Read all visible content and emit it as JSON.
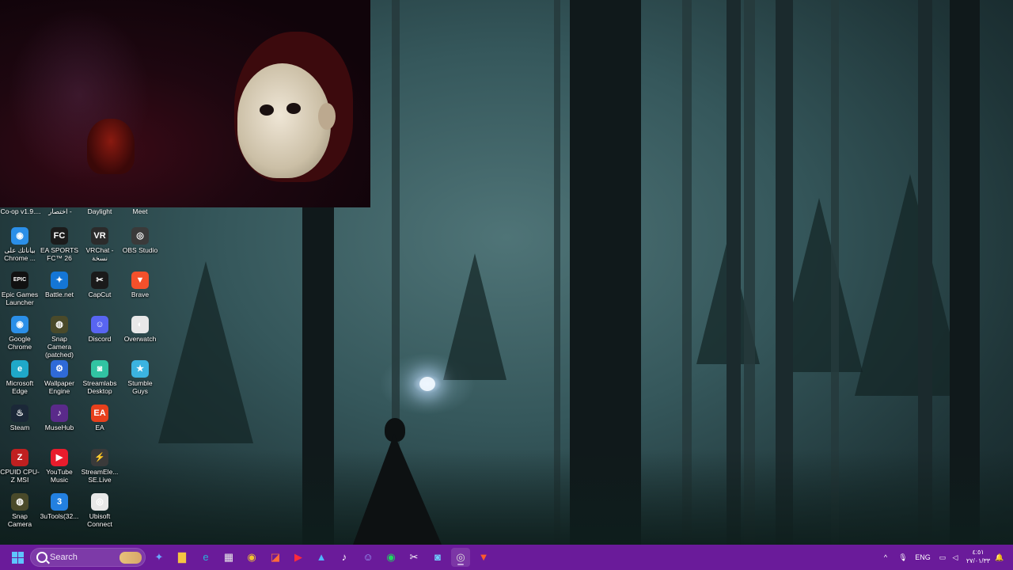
{
  "desktop": {
    "top_labels": [
      "Co-op v1.9....",
      "اختصار -",
      "Daylight",
      "Meet"
    ],
    "icons": [
      {
        "label": "بياناتك على Chrome ...",
        "icon": "chrome-icon",
        "color": "#2b8fe8",
        "glyph": "◉"
      },
      {
        "label": "EA SPORTS FC™ 26",
        "icon": "ea-sports-fc-icon",
        "color": "#1b1b1b",
        "glyph": "FC"
      },
      {
        "label": "VRChat - نسخة",
        "icon": "vrchat-icon",
        "color": "#2b2b2b",
        "glyph": "VR"
      },
      {
        "label": "OBS Studio",
        "icon": "obs-icon",
        "color": "#3a3a3a",
        "glyph": "◎"
      },
      {
        "label": "Epic Games Launcher",
        "icon": "epic-games-icon",
        "color": "#111111",
        "glyph": "EPIC"
      },
      {
        "label": "Battle.net",
        "icon": "battlenet-icon",
        "color": "#1476d6",
        "glyph": "✦"
      },
      {
        "label": "CapCut",
        "icon": "capcut-icon",
        "color": "#1a1a1a",
        "glyph": "✂"
      },
      {
        "label": "Brave",
        "icon": "brave-icon",
        "color": "#f4502b",
        "glyph": "▼"
      },
      {
        "label": "Google Chrome",
        "icon": "chrome-icon",
        "color": "#2b8fe8",
        "glyph": "◉"
      },
      {
        "label": "Snap Camera (patched)",
        "icon": "snap-camera-icon",
        "color": "#4a4a2a",
        "glyph": "◍"
      },
      {
        "label": "Discord",
        "icon": "discord-icon",
        "color": "#5865f2",
        "glyph": "☺"
      },
      {
        "label": "Overwatch",
        "icon": "overwatch-icon",
        "color": "#e8e8e8",
        "glyph": "◐"
      },
      {
        "label": "Microsoft Edge",
        "icon": "edge-icon",
        "color": "#1fa8c9",
        "glyph": "e"
      },
      {
        "label": "Wallpaper Engine",
        "icon": "wallpaper-engine-icon",
        "color": "#2f6ad8",
        "glyph": "⚙"
      },
      {
        "label": "Streamlabs Desktop",
        "icon": "streamlabs-icon",
        "color": "#31c3a2",
        "glyph": "◙"
      },
      {
        "label": "Stumble Guys",
        "icon": "stumble-guys-icon",
        "color": "#3bb3e0",
        "glyph": "★"
      },
      {
        "label": "Steam",
        "icon": "steam-icon",
        "color": "#1b2838",
        "glyph": "♨"
      },
      {
        "label": "MuseHub",
        "icon": "musehub-icon",
        "color": "#5a2a8a",
        "glyph": "♪"
      },
      {
        "label": "EA",
        "icon": "ea-icon",
        "color": "#e8401c",
        "glyph": "EA"
      },
      {
        "label": "",
        "icon": "",
        "color": "",
        "glyph": ""
      },
      {
        "label": "CPUID CPU-Z MSI",
        "icon": "cpu-z-icon",
        "color": "#c02020",
        "glyph": "Z"
      },
      {
        "label": "YouTube Music",
        "icon": "youtube-music-icon",
        "color": "#e81c2c",
        "glyph": "▶"
      },
      {
        "label": "StreamEle... SE.Live",
        "icon": "streamelements-icon",
        "color": "#3a3a3a",
        "glyph": "⚡"
      },
      {
        "label": "",
        "icon": "",
        "color": "",
        "glyph": ""
      },
      {
        "label": "Snap Camera",
        "icon": "snap-camera-icon",
        "color": "#4a4a2a",
        "glyph": "◍"
      },
      {
        "label": "3uTools(32...",
        "icon": "3utools-icon",
        "color": "#2380e0",
        "glyph": "3"
      },
      {
        "label": "Ubisoft Connect",
        "icon": "ubisoft-connect-icon",
        "color": "#e8e8e8",
        "glyph": "◎"
      },
      {
        "label": "",
        "icon": "",
        "color": "",
        "glyph": ""
      }
    ]
  },
  "taskbar": {
    "search_placeholder": "Search",
    "apps": [
      {
        "name": "copilot-icon",
        "glyph": "✦",
        "color": "#6aa7ff"
      },
      {
        "name": "file-explorer-icon",
        "glyph": "▇",
        "color": "#f5c542"
      },
      {
        "name": "edge-icon",
        "glyph": "e",
        "color": "#28b2d9"
      },
      {
        "name": "microsoft-store-icon",
        "glyph": "▦",
        "color": "#eaeaea"
      },
      {
        "name": "chrome-icon",
        "glyph": "◉",
        "color": "#f2c230"
      },
      {
        "name": "capcut-icon",
        "glyph": "◪",
        "color": "#ff6a3a"
      },
      {
        "name": "youtube-music-icon",
        "glyph": "▶",
        "color": "#ff2b3b"
      },
      {
        "name": "photos-icon",
        "glyph": "▲",
        "color": "#4fb5ff"
      },
      {
        "name": "tiktok-icon",
        "glyph": "♪",
        "color": "#ffffff"
      },
      {
        "name": "discord-icon",
        "glyph": "☺",
        "color": "#9aa4ff"
      },
      {
        "name": "spotify-icon",
        "glyph": "◉",
        "color": "#1ed760"
      },
      {
        "name": "capcut-editor-icon",
        "glyph": "✂",
        "color": "#ffffff"
      },
      {
        "name": "streamlabs-icon",
        "glyph": "◙",
        "color": "#6fd0ff"
      },
      {
        "name": "obs-icon",
        "glyph": "◎",
        "color": "#dddddd"
      },
      {
        "name": "brave-icon",
        "glyph": "▼",
        "color": "#ff5a2b"
      }
    ],
    "tray": {
      "language": "ENG",
      "clock_time": "٤:٥١",
      "clock_date": "٢٧/٠١/٣٣"
    }
  },
  "colors": {
    "taskbar": "#6a1b9a"
  }
}
